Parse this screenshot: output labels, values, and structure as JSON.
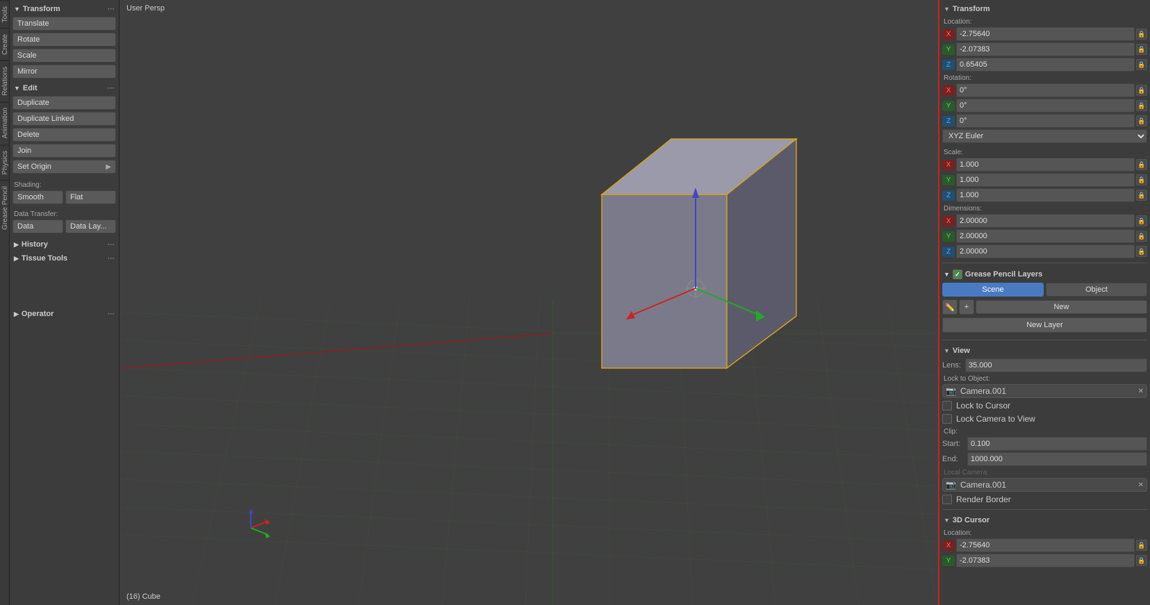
{
  "leftTabs": [
    "Tools",
    "Create",
    "Relations",
    "Animation",
    "Physics",
    "Grease Pencil"
  ],
  "leftPanel": {
    "transform": {
      "header": "Transform",
      "buttons": [
        "Translate",
        "Rotate",
        "Scale",
        "Mirror"
      ]
    },
    "edit": {
      "header": "Edit",
      "buttons": [
        "Duplicate",
        "Duplicate Linked",
        "Delete",
        "Join"
      ]
    },
    "setOrigin": "Set Origin",
    "shading": {
      "label": "Shading:",
      "smooth": "Smooth",
      "flat": "Flat"
    },
    "dataTransfer": {
      "label": "Data Transfer:",
      "data": "Data",
      "dataLay": "Data Lay..."
    },
    "history": "History",
    "tissueTools": "Tissue Tools",
    "operator": "Operator"
  },
  "viewport": {
    "header": "User Persp",
    "footer": "(16) Cube"
  },
  "rightPanel": {
    "transform": {
      "header": "Transform",
      "location": {
        "label": "Location:",
        "x": "-2.75640",
        "y": "-2.07383",
        "z": "0.65405"
      },
      "rotation": {
        "label": "Rotation:",
        "x": "0°",
        "y": "0°",
        "z": "0°"
      },
      "rotationMode": "XYZ Euler",
      "scale": {
        "label": "Scale:",
        "x": "1.000",
        "y": "1.000",
        "z": "1.000"
      },
      "dimensions": {
        "label": "Dimensions:",
        "x": "2.00000",
        "y": "2.00000",
        "z": "2.00000"
      }
    },
    "greasePencilLayers": {
      "header": "Grease Pencil Layers",
      "sceneTab": "Scene",
      "objectTab": "Object",
      "newBtn": "New",
      "newLayerBtn": "New Layer"
    },
    "view": {
      "header": "View",
      "lens": {
        "label": "Lens:",
        "value": "35.000"
      },
      "lockToObject": {
        "label": "Lock to Object:",
        "cameraName": "Camera.001"
      },
      "lockToCursor": "Lock to Cursor",
      "lockCameraToView": "Lock Camera to View",
      "clip": {
        "label": "Clip:",
        "startLabel": "Start:",
        "startValue": "0.100",
        "endLabel": "End:",
        "endValue": "1000.000"
      },
      "localCamera": "Local Camera:"
    },
    "cursor3D": {
      "header": "3D Cursor",
      "location": {
        "label": "Location:",
        "x": "-2.75640",
        "y": "-2.07383"
      }
    }
  }
}
